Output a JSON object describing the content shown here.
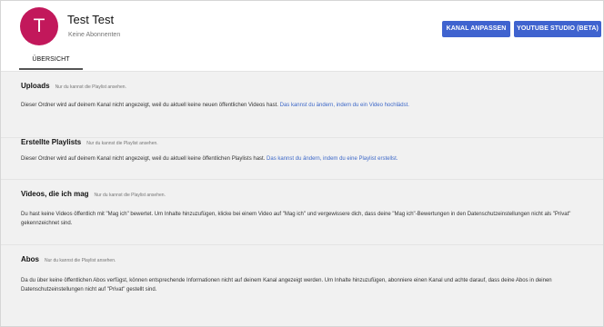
{
  "channel": {
    "avatar_letter": "T",
    "name": "Test Test",
    "subscribers": "Keine Abonnenten"
  },
  "buttons": {
    "customize": "KANAL ANPASSEN",
    "studio": "YOUTUBE STUDIO (BETA)"
  },
  "tabs": [
    {
      "label": "ÜBERSICHT",
      "selected": true
    }
  ],
  "sections": [
    {
      "title": "Uploads",
      "note": "Nur du kannst die Playlist ansehen.",
      "text": "Dieser Ordner wird auf deinem Kanal nicht angezeigt, weil du aktuell keine neuen öffentlichen Videos hast.",
      "link": "Das kannst du ändern, indem du ein Video hochlädst."
    },
    {
      "title": "Erstellte Playlists",
      "note": "Nur du kannst die Playlist ansehen.",
      "text": "Dieser Ordner wird auf deinem Kanal nicht angezeigt, weil du aktuell keine öffentlichen Playlists hast.",
      "link": "Das kannst du ändern, indem du eine Playlist erstellst."
    },
    {
      "title": "Videos, die ich mag",
      "note": "Nur du kannst die Playlist ansehen.",
      "text": "Du hast keine Videos öffentlich mit \"Mag ich\" bewertet. Um Inhalte hinzuzufügen, klicke bei einem Video auf \"Mag ich\" und vergewissere dich, dass deine \"Mag ich\"-Bewertungen in den Datenschutzeinstellungen nicht als \"Privat\" gekennzeichnet sind."
    },
    {
      "title": "Abos",
      "note": "Nur du kannst die Playlist ansehen.",
      "text": "Da du über keine öffentlichen Abos verfügst, können entsprechende Informationen nicht auf deinem Kanal angezeigt werden. Um Inhalte hinzuzufügen, abonniere einen Kanal und achte darauf, dass deine Abos in deinen Datenschutzeinstellungen nicht auf \"Privat\" gestellt sind."
    }
  ],
  "colors": {
    "avatar": "#c2185b",
    "button": "#3f63cf",
    "link": "#3d68c8",
    "background": "#f1f1f1"
  }
}
